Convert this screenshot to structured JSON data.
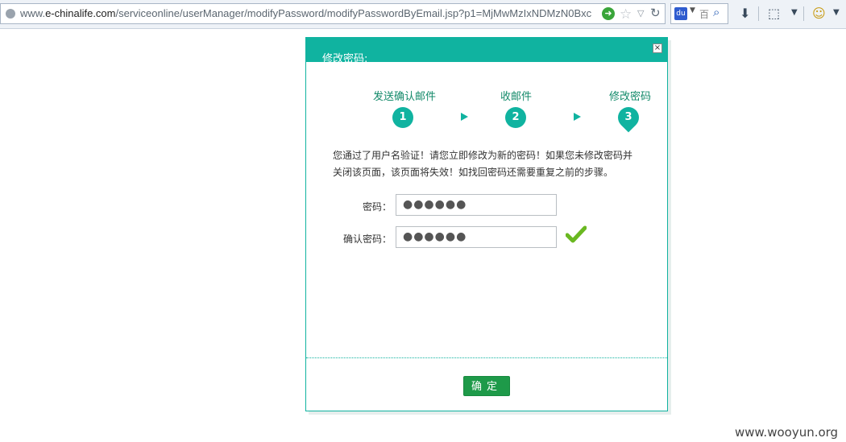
{
  "browser": {
    "url_prefix": "www.",
    "url_domain": "e-chinalife.com",
    "url_path": "/serviceonline/userManager/modifyPassword/modifyPasswordByEmail.jsp?p1=MjMwMzIxNDMzN0Bxc",
    "search_placeholder": "百"
  },
  "dialog": {
    "title": "修改密码:",
    "close_label": "×",
    "steps": [
      {
        "label": "发送确认邮件",
        "number": "1"
      },
      {
        "label": "收邮件",
        "number": "2"
      },
      {
        "label": "修改密码",
        "number": "3"
      }
    ],
    "notice_line1": "您通过了用户名验证！请您立即修改为新的密码！如果您未修改密码并",
    "notice_line2": "关闭该页面，该页面将失效！如找回密码还需要重复之前的步骤。",
    "password_label": "密码：",
    "password_value": "●●●●●●",
    "confirm_label": "确认密码：",
    "confirm_value": "●●●●●●",
    "ok_label": "确定"
  },
  "watermark": "www.wooyun.org",
  "colors": {
    "accent": "#10b3a0",
    "ok_button": "#1e9a49",
    "check": "#6ab821"
  }
}
